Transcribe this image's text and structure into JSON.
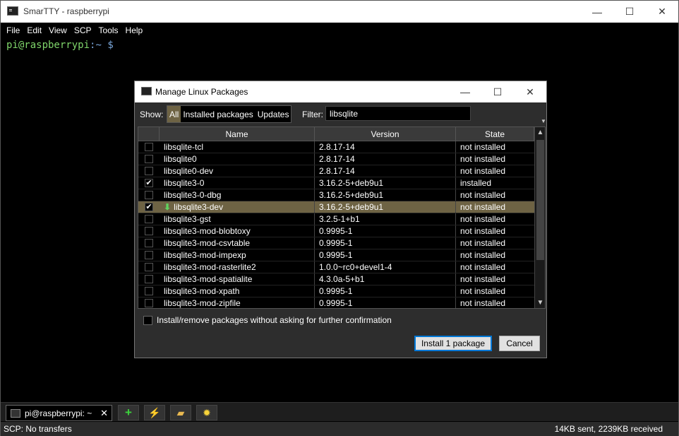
{
  "window": {
    "title": "SmarTTY - raspberrypi",
    "controls": {
      "minimize": "—",
      "maximize": "☐",
      "close": "✕"
    }
  },
  "menu": [
    "File",
    "Edit",
    "View",
    "SCP",
    "Tools",
    "Help"
  ],
  "terminal": {
    "user_host": "pi@raspberrypi",
    "sep": ":",
    "path": "~",
    "dollar": "$"
  },
  "dialog": {
    "title": "Manage Linux Packages",
    "controls": {
      "minimize": "—",
      "maximize": "☐",
      "close": "✕"
    },
    "show_label": "Show:",
    "show_options": [
      "All",
      "Installed packages",
      "Updates"
    ],
    "show_selected": "All",
    "filter_label": "Filter:",
    "filter_value": "libsqlite",
    "columns": {
      "name": "Name",
      "version": "Version",
      "state": "State"
    },
    "rows": [
      {
        "checked": false,
        "name": "libsqlite-tcl",
        "version": "2.8.17-14",
        "state": "not installed",
        "selected": false,
        "marked": false
      },
      {
        "checked": false,
        "name": "libsqlite0",
        "version": "2.8.17-14",
        "state": "not installed",
        "selected": false,
        "marked": false
      },
      {
        "checked": false,
        "name": "libsqlite0-dev",
        "version": "2.8.17-14",
        "state": "not installed",
        "selected": false,
        "marked": false
      },
      {
        "checked": true,
        "name": "libsqlite3-0",
        "version": "3.16.2-5+deb9u1",
        "state": "installed",
        "selected": false,
        "marked": false
      },
      {
        "checked": false,
        "name": "libsqlite3-0-dbg",
        "version": "3.16.2-5+deb9u1",
        "state": "not installed",
        "selected": false,
        "marked": false
      },
      {
        "checked": true,
        "name": "libsqlite3-dev",
        "version": "3.16.2-5+deb9u1",
        "state": "not installed",
        "selected": true,
        "marked": true
      },
      {
        "checked": false,
        "name": "libsqlite3-gst",
        "version": "3.2.5-1+b1",
        "state": "not installed",
        "selected": false,
        "marked": false
      },
      {
        "checked": false,
        "name": "libsqlite3-mod-blobtoxy",
        "version": "0.9995-1",
        "state": "not installed",
        "selected": false,
        "marked": false
      },
      {
        "checked": false,
        "name": "libsqlite3-mod-csvtable",
        "version": "0.9995-1",
        "state": "not installed",
        "selected": false,
        "marked": false
      },
      {
        "checked": false,
        "name": "libsqlite3-mod-impexp",
        "version": "0.9995-1",
        "state": "not installed",
        "selected": false,
        "marked": false
      },
      {
        "checked": false,
        "name": "libsqlite3-mod-rasterlite2",
        "version": "1.0.0~rc0+devel1-4",
        "state": "not installed",
        "selected": false,
        "marked": false
      },
      {
        "checked": false,
        "name": "libsqlite3-mod-spatialite",
        "version": "4.3.0a-5+b1",
        "state": "not installed",
        "selected": false,
        "marked": false
      },
      {
        "checked": false,
        "name": "libsqlite3-mod-xpath",
        "version": "0.9995-1",
        "state": "not installed",
        "selected": false,
        "marked": false
      },
      {
        "checked": false,
        "name": "libsqlite3-mod-zipfile",
        "version": "0.9995-1",
        "state": "not installed",
        "selected": false,
        "marked": false
      }
    ],
    "confirm_label": "Install/remove packages without asking for further confirmation",
    "confirm_checked": false,
    "install_button": "Install 1 package",
    "cancel_button": "Cancel"
  },
  "tabs": [
    {
      "label": "pi@raspberrypi: ~",
      "close": "✕"
    }
  ],
  "toolbar_icons": [
    "add-icon",
    "lightning-icon",
    "folder-icon",
    "sun-icon"
  ],
  "status": {
    "left": "SCP: No transfers",
    "right": "14KB sent, 2239KB received"
  }
}
